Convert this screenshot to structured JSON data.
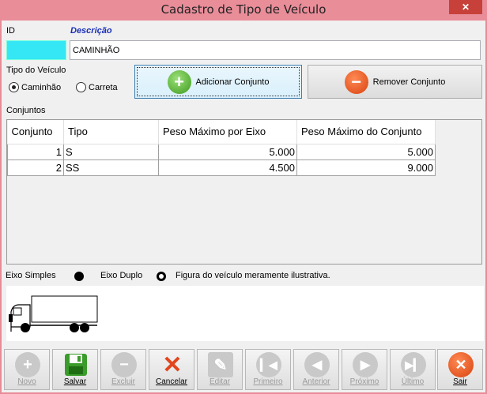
{
  "window": {
    "title": "Cadastro de Tipo de Veículo",
    "close": "✕"
  },
  "form": {
    "id_label": "ID",
    "id_value": "",
    "descricao_label": "Descrição",
    "descricao_value": "CAMINHÃO",
    "tipo_label": "Tipo do Veículo",
    "tipo_options": [
      "Caminhão",
      "Carreta"
    ],
    "tipo_selected": "Caminhão"
  },
  "buttons": {
    "add": "Adicionar Conjunto",
    "remove": "Remover Conjunto"
  },
  "conjuntos": {
    "label": "Conjuntos",
    "columns": [
      "Conjunto",
      "Tipo",
      "Peso Máximo por Eixo",
      "Peso Máximo do Conjunto"
    ],
    "rows": [
      [
        "1",
        "S",
        "5.000",
        "5.000"
      ],
      [
        "2",
        "SS",
        "4.500",
        "9.000"
      ]
    ]
  },
  "legend": {
    "simples": "Eixo Simples",
    "duplo": "Eixo Duplo",
    "note": "Figura do veículo meramente ilustrativa."
  },
  "toolbar": [
    {
      "label": "Novo",
      "icon": "plus-icon",
      "enabled": false
    },
    {
      "label": "Salvar",
      "icon": "save-icon",
      "enabled": true
    },
    {
      "label": "Excluir",
      "icon": "minus-icon",
      "enabled": false
    },
    {
      "label": "Cancelar",
      "icon": "cancel-x-icon",
      "enabled": true
    },
    {
      "label": "Editar",
      "icon": "edit-icon",
      "enabled": false
    },
    {
      "label": "Primeiro",
      "icon": "first-icon",
      "enabled": false
    },
    {
      "label": "Anterior",
      "icon": "previous-icon",
      "enabled": false
    },
    {
      "label": "Próximo",
      "icon": "next-icon",
      "enabled": false
    },
    {
      "label": "Último",
      "icon": "last-icon",
      "enabled": false
    },
    {
      "label": "Sair",
      "icon": "exit-icon",
      "enabled": true
    }
  ],
  "colors": {
    "titlebar": "#e98d99",
    "id_field": "#35e6f4",
    "descricao_label": "#1a2fb8"
  }
}
